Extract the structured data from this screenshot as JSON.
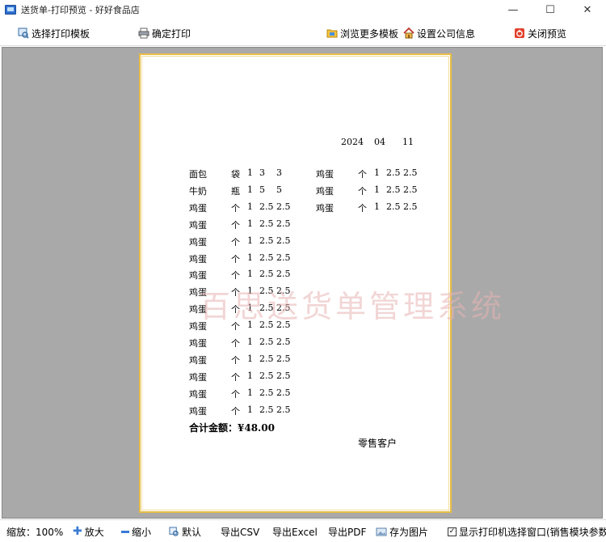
{
  "window": {
    "title": "送货单-打印预览 - 好好食品店",
    "minimize_glyph": "—",
    "maximize_glyph": "☐",
    "close_glyph": "✕"
  },
  "toolbar": {
    "select_template": "选择打印模板",
    "confirm_print": "确定打印",
    "browse_templates": "浏览更多模板",
    "company_settings": "设置公司信息",
    "close_preview": "关闭预览"
  },
  "document": {
    "date": {
      "year": "2024",
      "month": "04",
      "day": "11"
    },
    "left_rows": [
      {
        "name": "面包",
        "unit": "袋",
        "qty": "1",
        "price": "3",
        "amount": "3"
      },
      {
        "name": "牛奶",
        "unit": "瓶",
        "qty": "1",
        "price": "5",
        "amount": "5"
      },
      {
        "name": "鸡蛋",
        "unit": "个",
        "qty": "1",
        "price": "2.5",
        "amount": "2.5"
      },
      {
        "name": "鸡蛋",
        "unit": "个",
        "qty": "1",
        "price": "2.5",
        "amount": "2.5"
      },
      {
        "name": "鸡蛋",
        "unit": "个",
        "qty": "1",
        "price": "2.5",
        "amount": "2.5"
      },
      {
        "name": "鸡蛋",
        "unit": "个",
        "qty": "1",
        "price": "2.5",
        "amount": "2.5"
      },
      {
        "name": "鸡蛋",
        "unit": "个",
        "qty": "1",
        "price": "2.5",
        "amount": "2.5"
      },
      {
        "name": "鸡蛋",
        "unit": "个",
        "qty": "1",
        "price": "2.5",
        "amount": "2.5"
      },
      {
        "name": "鸡蛋",
        "unit": "个",
        "qty": "1",
        "price": "2.5",
        "amount": "2.5"
      },
      {
        "name": "鸡蛋",
        "unit": "个",
        "qty": "1",
        "price": "2.5",
        "amount": "2.5"
      },
      {
        "name": "鸡蛋",
        "unit": "个",
        "qty": "1",
        "price": "2.5",
        "amount": "2.5"
      },
      {
        "name": "鸡蛋",
        "unit": "个",
        "qty": "1",
        "price": "2.5",
        "amount": "2.5"
      },
      {
        "name": "鸡蛋",
        "unit": "个",
        "qty": "1",
        "price": "2.5",
        "amount": "2.5"
      },
      {
        "name": "鸡蛋",
        "unit": "个",
        "qty": "1",
        "price": "2.5",
        "amount": "2.5"
      },
      {
        "name": "鸡蛋",
        "unit": "个",
        "qty": "1",
        "price": "2.5",
        "amount": "2.5"
      }
    ],
    "right_rows": [
      {
        "name": "鸡蛋",
        "unit": "个",
        "qty": "1",
        "price": "2.5",
        "amount": "2.5"
      },
      {
        "name": "鸡蛋",
        "unit": "个",
        "qty": "1",
        "price": "2.5",
        "amount": "2.5"
      },
      {
        "name": "鸡蛋",
        "unit": "个",
        "qty": "1",
        "price": "2.5",
        "amount": "2.5"
      }
    ],
    "total": "合计金额：¥48.00",
    "customer": "零售客户",
    "watermark": "百思送货单管理系统"
  },
  "statusbar": {
    "zoom": "缩放：100%",
    "zoom_in": "放大",
    "zoom_out": "缩小",
    "default": "默认",
    "export_csv": "导出CSV",
    "export_excel": "导出Excel",
    "export_pdf": "导出PDF",
    "save_image": "存为图片",
    "show_printer_dialog": "显示打印机选择窗口(销售模块参数)",
    "show_printer_dialog_checked": true
  },
  "colors": {
    "workspace": "#a9a9a9",
    "paper_border": "#e8bd45",
    "watermark": "#e8b4b4"
  }
}
